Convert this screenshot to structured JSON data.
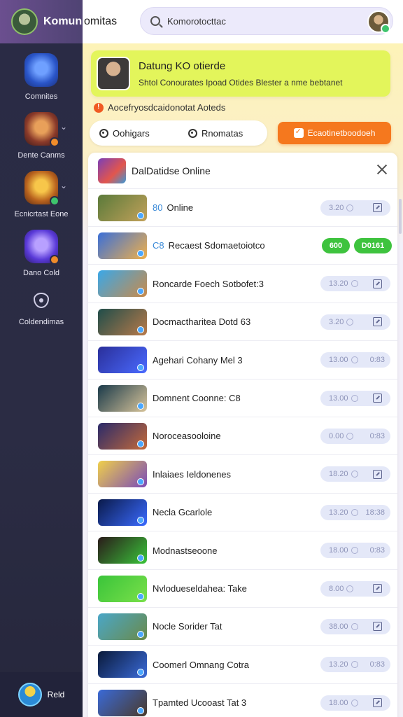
{
  "sidebar": {
    "brand": "Komuni",
    "items": [
      {
        "label": "Comnites"
      },
      {
        "label": "Dente Canms"
      },
      {
        "label": "Ecnicrtast Eone"
      },
      {
        "label": "Dano Cold"
      },
      {
        "label": "Coldendimas"
      }
    ],
    "user": {
      "name": "Reld"
    }
  },
  "header": {
    "title": "omitas",
    "search": {
      "value": "Komorotocttac",
      "placeholder": "Komorotocttac"
    }
  },
  "banner": {
    "title": "Datung KO otierde",
    "subtitle": "Shtol Conourates Ipoad Otides Blester a nme bebtanet"
  },
  "notice": "Aocefryosdcaidonotat Aoteds",
  "filters": [
    {
      "label": "Oohigars"
    },
    {
      "label": "Rnomatas"
    }
  ],
  "cta": {
    "label": "Ecaotinetboodoeh"
  },
  "panel": {
    "title": "DalDatidse Online",
    "rows": [
      {
        "prefix": "80",
        "title": "Online",
        "time": "3.20",
        "kind": "edit",
        "thumb": [
          "#5a7a3a",
          "#c2a15a"
        ]
      },
      {
        "prefix": "C8",
        "title": "Recaest Sdomaetoiotco",
        "green": [
          "600",
          "D0161"
        ],
        "kind": "green",
        "thumb": [
          "#3a6fd8",
          "#f0b04a"
        ]
      },
      {
        "title": "Roncarde Foech Sotbofet:3",
        "time": "13.20",
        "kind": "edit",
        "thumb": [
          "#3aa8e8",
          "#c98a4a"
        ]
      },
      {
        "title": "Docmactharitea Dotd 63",
        "time": "3.20",
        "kind": "edit",
        "thumb": [
          "#1f4d4a",
          "#b87a4a"
        ]
      },
      {
        "title": "Agehari Cohany Mel 3",
        "time": "13.00",
        "timeright": "0:83",
        "kind": "time",
        "thumb": [
          "#2a2f9a",
          "#4a6aff"
        ]
      },
      {
        "title": "Domnent Coonne: C8",
        "time": "13.00",
        "kind": "edit",
        "thumb": [
          "#1a3a4a",
          "#d8c49a"
        ]
      },
      {
        "title": "Noroceasooloine",
        "time": "0.00",
        "timeright": "0:83",
        "kind": "time",
        "thumb": [
          "#2a2a6a",
          "#c46a3a"
        ]
      },
      {
        "title": "Inlaiaes Ieldonenes",
        "time": "18.20",
        "kind": "edit",
        "thumb": [
          "#f0d04a",
          "#7a4ab8"
        ]
      },
      {
        "title": "Necla Gcarlole",
        "time": "13.20",
        "timeright": "18:38",
        "kind": "time",
        "thumb": [
          "#0a1a4a",
          "#3a6aff"
        ]
      },
      {
        "title": "Modnastseoone",
        "time": "18.00",
        "timeright": "0:83",
        "kind": "time",
        "thumb": [
          "#2a1a1a",
          "#3ac43a"
        ]
      },
      {
        "title": "Nvlodueseldahea: Take",
        "time": "8.00",
        "kind": "edit",
        "thumb": [
          "#3ac43a",
          "#7ae04a"
        ]
      },
      {
        "title": "Nocle Sorider Tat",
        "time": "38.00",
        "kind": "edit",
        "thumb": [
          "#4aa7c8",
          "#6a8a4a"
        ]
      },
      {
        "title": "Coomerl Omnang Cotra",
        "time": "13.20",
        "timeright": "0:83",
        "kind": "time",
        "thumb": [
          "#0a1a3a",
          "#3a6ad8"
        ]
      },
      {
        "title": "Tpamted Ucooast Tat 3",
        "time": "18.00",
        "kind": "edit",
        "thumb": [
          "#3a6ad8",
          "#4a3a2a"
        ]
      }
    ]
  },
  "colors": {
    "sidebar": "#2a2b45",
    "banner": "#e3f55b",
    "cta": "#f5781e",
    "green_pill": "#3ec33e",
    "time_pill": "#e4e8f8"
  },
  "icons": {
    "search": "search-icon",
    "close": "close-icon",
    "edit": "edit-icon",
    "clock": "clock-icon",
    "chevron": "chevron-down-icon",
    "shield": "shield-icon"
  }
}
